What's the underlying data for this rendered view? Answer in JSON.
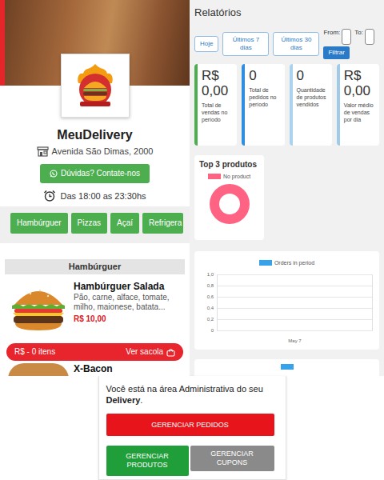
{
  "store": {
    "name": "MeuDelivery",
    "address": "Avenida São Dimas, 2000",
    "contact_button": "Dúvidas? Contate-nos",
    "hours": "Das 18:00 as 23:30hs"
  },
  "categories": [
    {
      "label": "Hambúrguer"
    },
    {
      "label": "Pizzas"
    },
    {
      "label": "Açaí"
    },
    {
      "label": "Refrigera"
    }
  ],
  "section": {
    "title": "Hambúrguer"
  },
  "products": [
    {
      "name": "Hambúrguer Salada",
      "description": "Pão, carne, alface, tomate, milho, maionese, batata...",
      "price": "R$ 10,00"
    },
    {
      "name": "X-Bacon"
    }
  ],
  "cart": {
    "summary": "R$ - 0 itens",
    "button": "Ver sacola"
  },
  "reports": {
    "title": "Relatórios",
    "ranges": [
      {
        "label": "Hoje"
      },
      {
        "label": "Últimos 7 dias"
      },
      {
        "label": "Últimos 30 dias"
      }
    ],
    "from_label": "From:",
    "to_label": "To:",
    "filter_button": "Filtrar",
    "stats": [
      {
        "value": "R$ 0,00",
        "label": "Total de vendas no período",
        "color": "#4cae4f"
      },
      {
        "value": "0",
        "label": "Total de pedidos no período",
        "color": "#2f8ee0"
      },
      {
        "value": "0",
        "label": "Quantidade de produtos vendidos",
        "color": "#a9d3ef"
      },
      {
        "value": "R$ 0,00",
        "label": "Valor médio de vendas por dia",
        "color": "#9fcbe9"
      }
    ],
    "top_products": {
      "title": "Top 3 produtos",
      "legend": "No product"
    },
    "orders_chart": {
      "legend": "Orders in period",
      "y_ticks": [
        "1,0",
        "0,8",
        "0,6",
        "0,4",
        "0,2",
        "0"
      ],
      "x_labels": [
        "May 7"
      ],
      "values": [
        0
      ]
    }
  },
  "admin": {
    "intro": "Você está na área Administrativa do seu ",
    "brand": "Delivery",
    "end": ".",
    "buttons": [
      {
        "label": "GERENCIAR PEDIDOS",
        "color": "#e8141b"
      },
      {
        "label": "GERENCIAR PRODUTOS",
        "color": "#1f9e3a"
      },
      {
        "label": "GERENCIAR CUPONS",
        "color": "#8a8a8a"
      }
    ]
  }
}
